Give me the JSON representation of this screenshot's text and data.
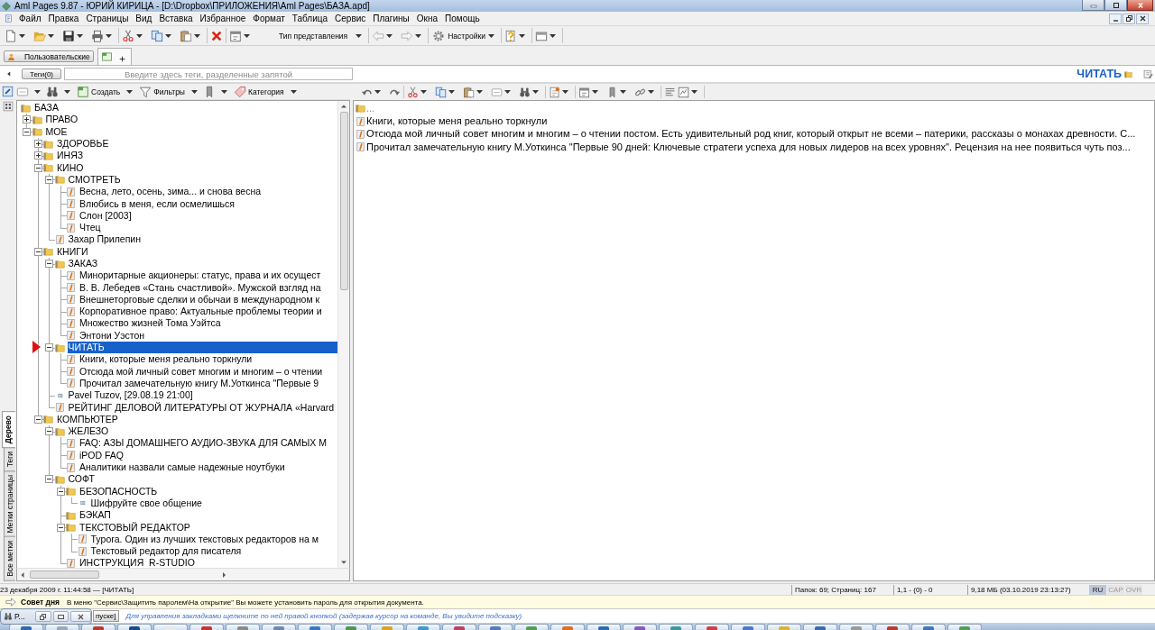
{
  "window": {
    "title": "Aml Pages 9.87 - ЮРИЙ КИРИЦА - [D:\\Dropbox\\ПРИЛОЖЕНИЯ\\Aml Pages\\БАЗА.apd]"
  },
  "menu": [
    "Файл",
    "Правка",
    "Страницы",
    "Вид",
    "Вставка",
    "Избранное",
    "Формат",
    "Таблица",
    "Сервис",
    "Плагины",
    "Окна",
    "Помощь"
  ],
  "toolbar": {
    "view_mode": "Тип представления",
    "settings": "Настройки"
  },
  "tabs_bar": {
    "profile_button": "Пользовательские"
  },
  "tags_bar": {
    "tags_button": "Теги(0)",
    "placeholder": "Введите здесь теги, разделенные запятой",
    "current_page": "ЧИТАТЬ"
  },
  "tree_toolbar": {
    "create": "Создать",
    "filters": "Фильтры",
    "category": "Категория"
  },
  "side_tabs": [
    {
      "label": "Дерево",
      "selected": true
    },
    {
      "label": "Теги",
      "selected": false
    },
    {
      "label": "Метки страницы",
      "selected": false
    },
    {
      "label": "Все метки",
      "selected": false
    }
  ],
  "tree": [
    {
      "label": "БАЗА",
      "kind": "folder",
      "selected": false,
      "children": [
        {
          "label": "ПРАВО",
          "kind": "folder",
          "selected": false,
          "expanded": false
        },
        {
          "label": "МОЕ",
          "kind": "folder",
          "selected": false,
          "expanded": true,
          "children": [
            {
              "label": "ЗДОРОВЬЕ",
              "kind": "folder",
              "selected": false,
              "expanded": false
            },
            {
              "label": "ИНЯЗ",
              "kind": "folder",
              "selected": false,
              "expanded": false
            },
            {
              "label": "КИНО",
              "kind": "folder",
              "selected": false,
              "expanded": true,
              "children": [
                {
                  "label": "СМОТРЕТЬ",
                  "kind": "folder",
                  "selected": false,
                  "expanded": true,
                  "children": [
                    {
                      "label": "Весна, лето, осень, зима... и снова весна",
                      "kind": "page",
                      "selected": false
                    },
                    {
                      "label": "Влюбись в меня, если осмелишься",
                      "kind": "page",
                      "selected": false
                    },
                    {
                      "label": "Слон [2003]",
                      "kind": "page",
                      "selected": false
                    },
                    {
                      "label": "Чтец",
                      "kind": "page",
                      "selected": false
                    }
                  ]
                },
                {
                  "label": "Захар Прилепин",
                  "kind": "page",
                  "selected": false
                }
              ]
            },
            {
              "label": "КНИГИ",
              "kind": "folder",
              "selected": false,
              "expanded": true,
              "children": [
                {
                  "label": "ЗАКАЗ",
                  "kind": "folder",
                  "selected": false,
                  "expanded": true,
                  "children": [
                    {
                      "label": "Миноритарные акционеры: статус, права и их осущест",
                      "kind": "page",
                      "selected": false
                    },
                    {
                      "label": "В. В. Лебедев «Стань счастливой». Мужской взгляд на",
                      "kind": "page",
                      "selected": false
                    },
                    {
                      "label": "Внешнеторговые сделки и обычаи в международном к",
                      "kind": "page",
                      "selected": false
                    },
                    {
                      "label": "Корпоративное право: Актуальные проблемы теории и",
                      "kind": "page",
                      "selected": false
                    },
                    {
                      "label": "Множество жизней Тома Уэйтса",
                      "kind": "page",
                      "selected": false
                    },
                    {
                      "label": "Энтони Уэстон",
                      "kind": "page",
                      "selected": false
                    }
                  ]
                },
                {
                  "label": "ЧИТАТЬ",
                  "kind": "folder",
                  "selected": true,
                  "expanded": true,
                  "children": [
                    {
                      "label": "Книги, которые меня реально торкнули",
                      "kind": "page",
                      "selected": false
                    },
                    {
                      "label": "Отсюда мой личный совет многим и многим – о чтении",
                      "kind": "page",
                      "selected": false
                    },
                    {
                      "label": "Прочитал замечательную книгу М.Уоткинса \"Первые 9",
                      "kind": "page",
                      "selected": false
                    }
                  ]
                },
                {
                  "label": "Pavel Tuzov, [29.08.19 21:00]",
                  "kind": "note",
                  "selected": false
                },
                {
                  "label": "РЕЙТИНГ ДЕЛОВОЙ ЛИТЕРАТУРЫ ОТ ЖУРНАЛА «Harvard",
                  "kind": "page",
                  "selected": false
                }
              ]
            },
            {
              "label": "КОМПЬЮТЕР",
              "kind": "folder",
              "selected": false,
              "expanded": true,
              "children": [
                {
                  "label": "ЖЕЛЕЗО",
                  "kind": "folder",
                  "selected": false,
                  "expanded": true,
                  "children": [
                    {
                      "label": "FAQ: АЗЫ ДОМАШНЕГО АУДИО-ЗВУКА ДЛЯ САМЫХ М",
                      "kind": "page",
                      "selected": false
                    },
                    {
                      "label": "iPOD FAQ",
                      "kind": "page",
                      "selected": false
                    },
                    {
                      "label": "Аналитики назвали самые надежные ноутбуки",
                      "kind": "page",
                      "selected": false
                    }
                  ]
                },
                {
                  "label": "СОФТ",
                  "kind": "folder",
                  "selected": false,
                  "expanded": true,
                  "children": [
                    {
                      "label": "БЕЗОПАСНОСТЬ",
                      "kind": "folder",
                      "selected": false,
                      "expanded": true,
                      "children": [
                        {
                          "label": "Шифруйте свое общение",
                          "kind": "note",
                          "selected": false
                        }
                      ]
                    },
                    {
                      "label": "БЭКАП",
                      "kind": "folder",
                      "selected": false
                    },
                    {
                      "label": "ТЕКСТОВЫЙ РЕДАКТОР",
                      "kind": "folder",
                      "selected": false,
                      "expanded": true,
                      "children": [
                        {
                          "label": "Typora. Один из лучших текстовых редакторов на м",
                          "kind": "page",
                          "selected": false
                        },
                        {
                          "label": "Текстовый редактор для писателя",
                          "kind": "page",
                          "selected": false
                        }
                      ]
                    },
                    {
                      "label": "ИНСТРУКЦИЯ  R-STUDIO",
                      "kind": "page",
                      "selected": false
                    }
                  ]
                }
              ]
            }
          ]
        }
      ]
    }
  ],
  "page_list": [
    {
      "kind": "folder",
      "text": "..."
    },
    {
      "kind": "page",
      "text": "Книги, которые меня реально торкнули"
    },
    {
      "kind": "page",
      "text": "Отсюда мой личный совет многим и многим – о чтении постом. Есть удивительный род книг, который открыт не всеми – патерики, рассказы о монахах древности. С..."
    },
    {
      "kind": "page",
      "text": "Прочитал замечательную книгу М.Уоткинса \"Первые 90 дней: Ключевые стратеги успеха для новых лидеров на всех уровнях\". Рецензия на нее появиться чуть поз..."
    }
  ],
  "status_bar": {
    "date": "23 декабря 2009 г. 11:44:58 — [ЧИТАТЬ]",
    "counts": "Папок: 69; Страниц: 167",
    "position": "1,1 - (0) - 0",
    "size": "9,18 МБ (03.10.2019 23:13:27)",
    "indicators": [
      {
        "label": "RU",
        "on": true
      },
      {
        "label": "CAP",
        "on": false
      },
      {
        "label": "OVR",
        "on": false
      }
    ]
  },
  "tip": {
    "title": "Совет дня",
    "text": "В меню \"Сервис\\Защитить паролем\\На открытие\" Вы можете установить пароль для открытия документа."
  },
  "bookmarks_bar": {
    "bookmarks": [
      "пуске]"
    ],
    "hint": "Для управления закладками щелкните по ней правой кнопкой (задержав курсор на команде, Вы увидите подсказку)"
  },
  "minimized_window": {
    "title": "P..."
  }
}
